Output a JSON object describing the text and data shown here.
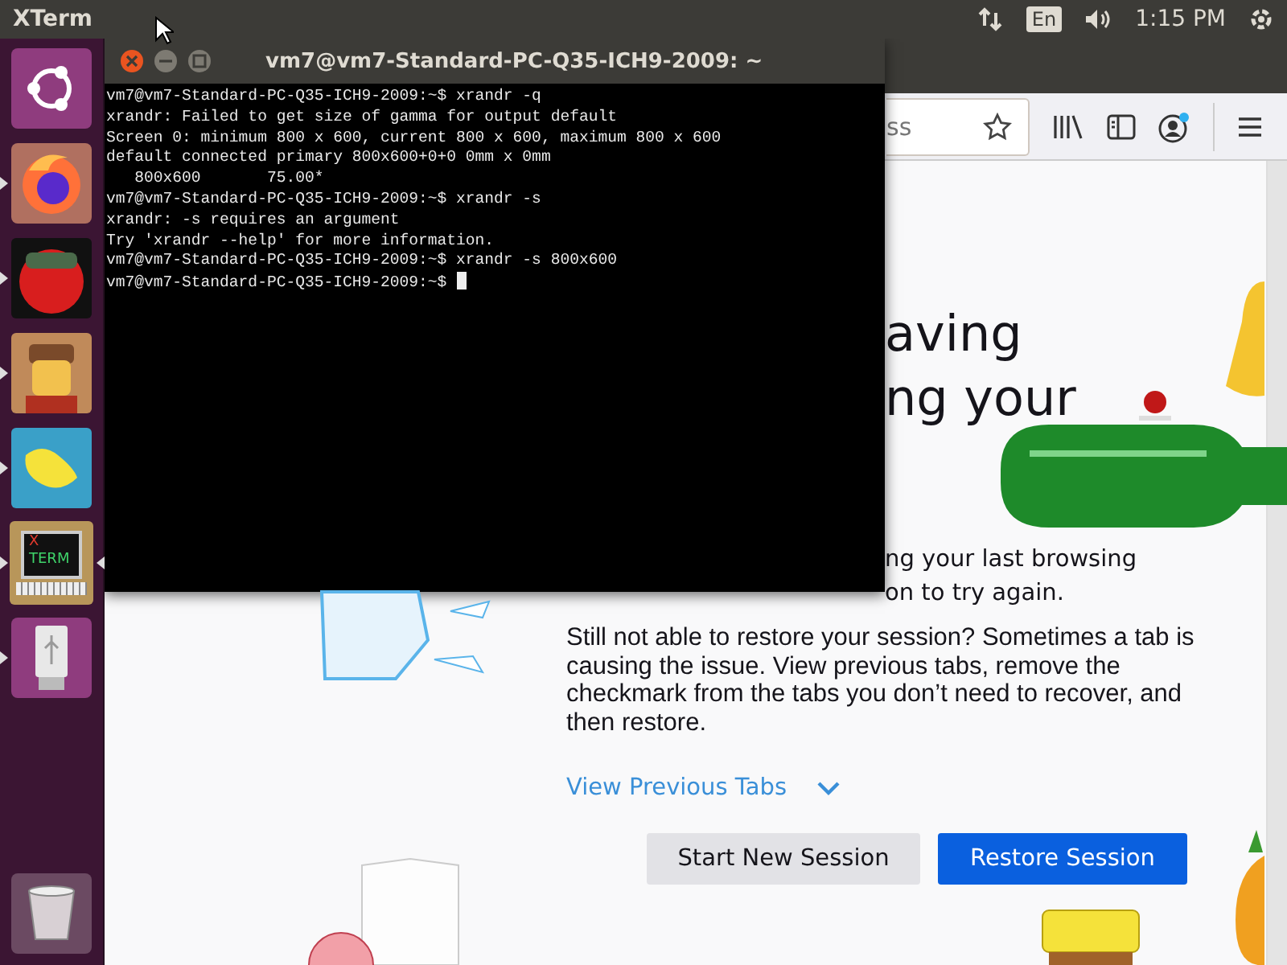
{
  "top_bar": {
    "app_name": "XTerm",
    "keyboard": "En",
    "time": "1:15 PM"
  },
  "launcher": {
    "items": [
      {
        "kind": "ubuntu",
        "running": false,
        "focused": false
      },
      {
        "kind": "firefox",
        "running": true,
        "focused": false
      },
      {
        "kind": "red",
        "running": true,
        "focused": false
      },
      {
        "kind": "figure",
        "running": true,
        "focused": false
      },
      {
        "kind": "blue",
        "running": true,
        "focused": false
      },
      {
        "kind": "xterm",
        "running": true,
        "focused": true,
        "icon_text": [
          "X",
          "TERM"
        ]
      },
      {
        "kind": "usb",
        "running": true,
        "focused": false
      },
      {
        "kind": "trash",
        "running": false,
        "focused": false
      }
    ]
  },
  "terminal": {
    "title": "vm7@vm7-Standard-PC-Q35-ICH9-2009: ~",
    "cursor_visible": true,
    "lines": [
      "vm7@vm7-Standard-PC-Q35-ICH9-2009:~$ xrandr -q",
      "xrandr: Failed to get size of gamma for output default",
      "Screen 0: minimum 800 x 600, current 800 x 600, maximum 800 x 600",
      "default connected primary 800x600+0+0 0mm x 0mm",
      "   800x600       75.00*",
      "vm7@vm7-Standard-PC-Q35-ICH9-2009:~$ xrandr -s",
      "xrandr: -s requires an argument",
      "Try 'xrandr --help' for more information.",
      "vm7@vm7-Standard-PC-Q35-ICH9-2009:~$ xrandr -s 800x600",
      "vm7@vm7-Standard-PC-Q35-ICH9-2009:~$ "
    ]
  },
  "browser": {
    "url_fragment": "ss",
    "account_badge": true,
    "heading_lines": [
      "aving",
      "ng your"
    ],
    "intro_lines": [
      "ng your last browsing",
      "on to try again."
    ],
    "paragraph": "Still not able to restore your session? Sometimes a tab is causing the issue. View previous tabs, remove the checkmark from the tabs you don’t need to recover, and then restore.",
    "view_tabs_link": "View Previous Tabs",
    "buttons": [
      {
        "label": "Start New Session",
        "kind": "secondary"
      },
      {
        "label": "Restore Session",
        "kind": "primary"
      }
    ]
  }
}
